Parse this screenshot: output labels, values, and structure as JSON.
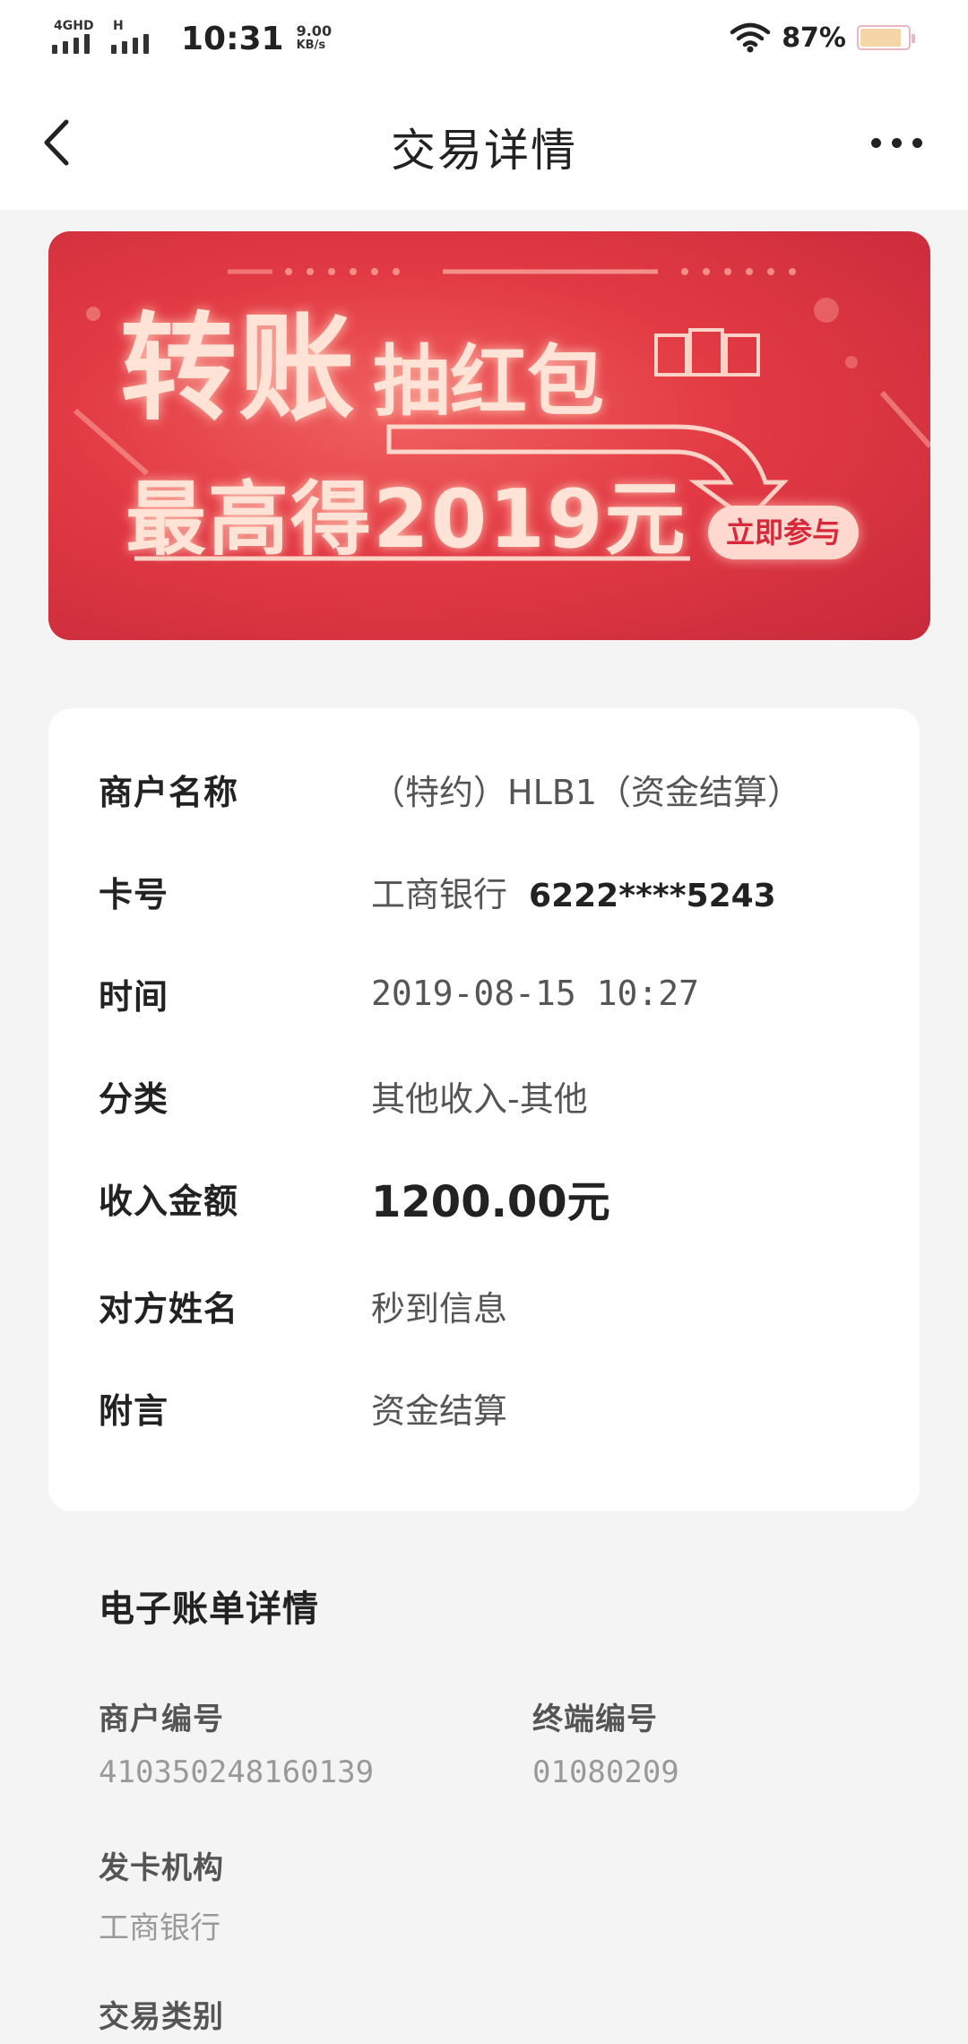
{
  "status_bar": {
    "network1": "4GHD",
    "network2": "H",
    "time": "10:31",
    "speed_value": "9.00",
    "speed_unit": "KB/s",
    "battery_percent": "87%",
    "battery_level": 0.87
  },
  "nav": {
    "title": "交易详情"
  },
  "banner": {
    "line1_big": "转账",
    "line1_mid": "抽红包",
    "line2": "最高得2019元",
    "button": "立即参与"
  },
  "details": {
    "merchant_label": "商户名称",
    "merchant_value": "（特约）HLB1（资金结算）",
    "card_label": "卡号",
    "card_bank": "工商银行",
    "card_number": "6222****5243",
    "time_label": "时间",
    "time_value": "2019-08-15 10:27",
    "category_label": "分类",
    "category_value": "其他收入-其他",
    "amount_label": "收入金额",
    "amount_value": "1200.00元",
    "counterparty_label": "对方姓名",
    "counterparty_value": "秒到信息",
    "note_label": "附言",
    "note_value": "资金结算"
  },
  "ebill": {
    "title": "电子账单详情",
    "merchant_no_label": "商户编号",
    "merchant_no_value": "410350248160139",
    "terminal_no_label": "终端编号",
    "terminal_no_value": "01080209",
    "issuer_label": "发卡机构",
    "issuer_value": "工商银行",
    "txn_type_label": "交易类别"
  }
}
